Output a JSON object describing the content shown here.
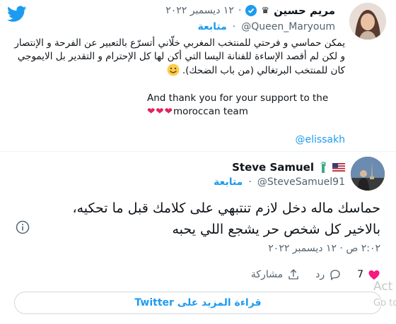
{
  "tweet": {
    "author_name": "مريم حسين",
    "author_badge": "♛",
    "date": "١٢ ديسمبر ٢٠٢٢",
    "handle": "@Queen_Maryoum",
    "follow_label": "متابعة",
    "quoted_text_ar": "يمكن حماسي و فرحتي للمنتخب المغربي خلّاني أتسرّع بالتعبير عن الفرحة و الإنتصار و لكن لم أقصد الإساءة للفنانة اليسا التي أكن لها كل الإحترام و التقدير بل الايموجي كان للمنتخب البرتغالي (من باب الضحك).",
    "quoted_text_en_1": "And thank you for your support to the",
    "quoted_text_en_2": "moroccan team",
    "hearts": "❤❤❤",
    "mention": "@elissakh"
  },
  "reply": {
    "author_name": "Steve Samuel",
    "handle": "@SteveSamuel91",
    "follow_label": "متابعة",
    "text_line1": "حماسك ماله دخل لازم تنتبهي على كلامك قبل ما تحكيه،",
    "text_line2": "بالاخير كل شخص حر يشجع اللي يحبه",
    "time": "٢:٠٢ ص · ١٢ ديسمبر ٢٠٢٢",
    "like_count": "7",
    "reply_label": "رد",
    "share_label": "مشاركة"
  },
  "read_more_label": "قراءة المزيد على Twitter",
  "watermark": {
    "line1": "Act",
    "line2": "Go to"
  },
  "icons": [
    "twitter-bird-icon",
    "verified-badge-icon",
    "smile-emoji-icon",
    "flag-icon",
    "liberty-icon",
    "info-icon",
    "heart-icon",
    "reply-icon",
    "share-icon"
  ],
  "colors": {
    "twitter_blue": "#1d9bf0",
    "like_red": "#f91880",
    "text": "#0f1419",
    "muted": "#536471"
  }
}
